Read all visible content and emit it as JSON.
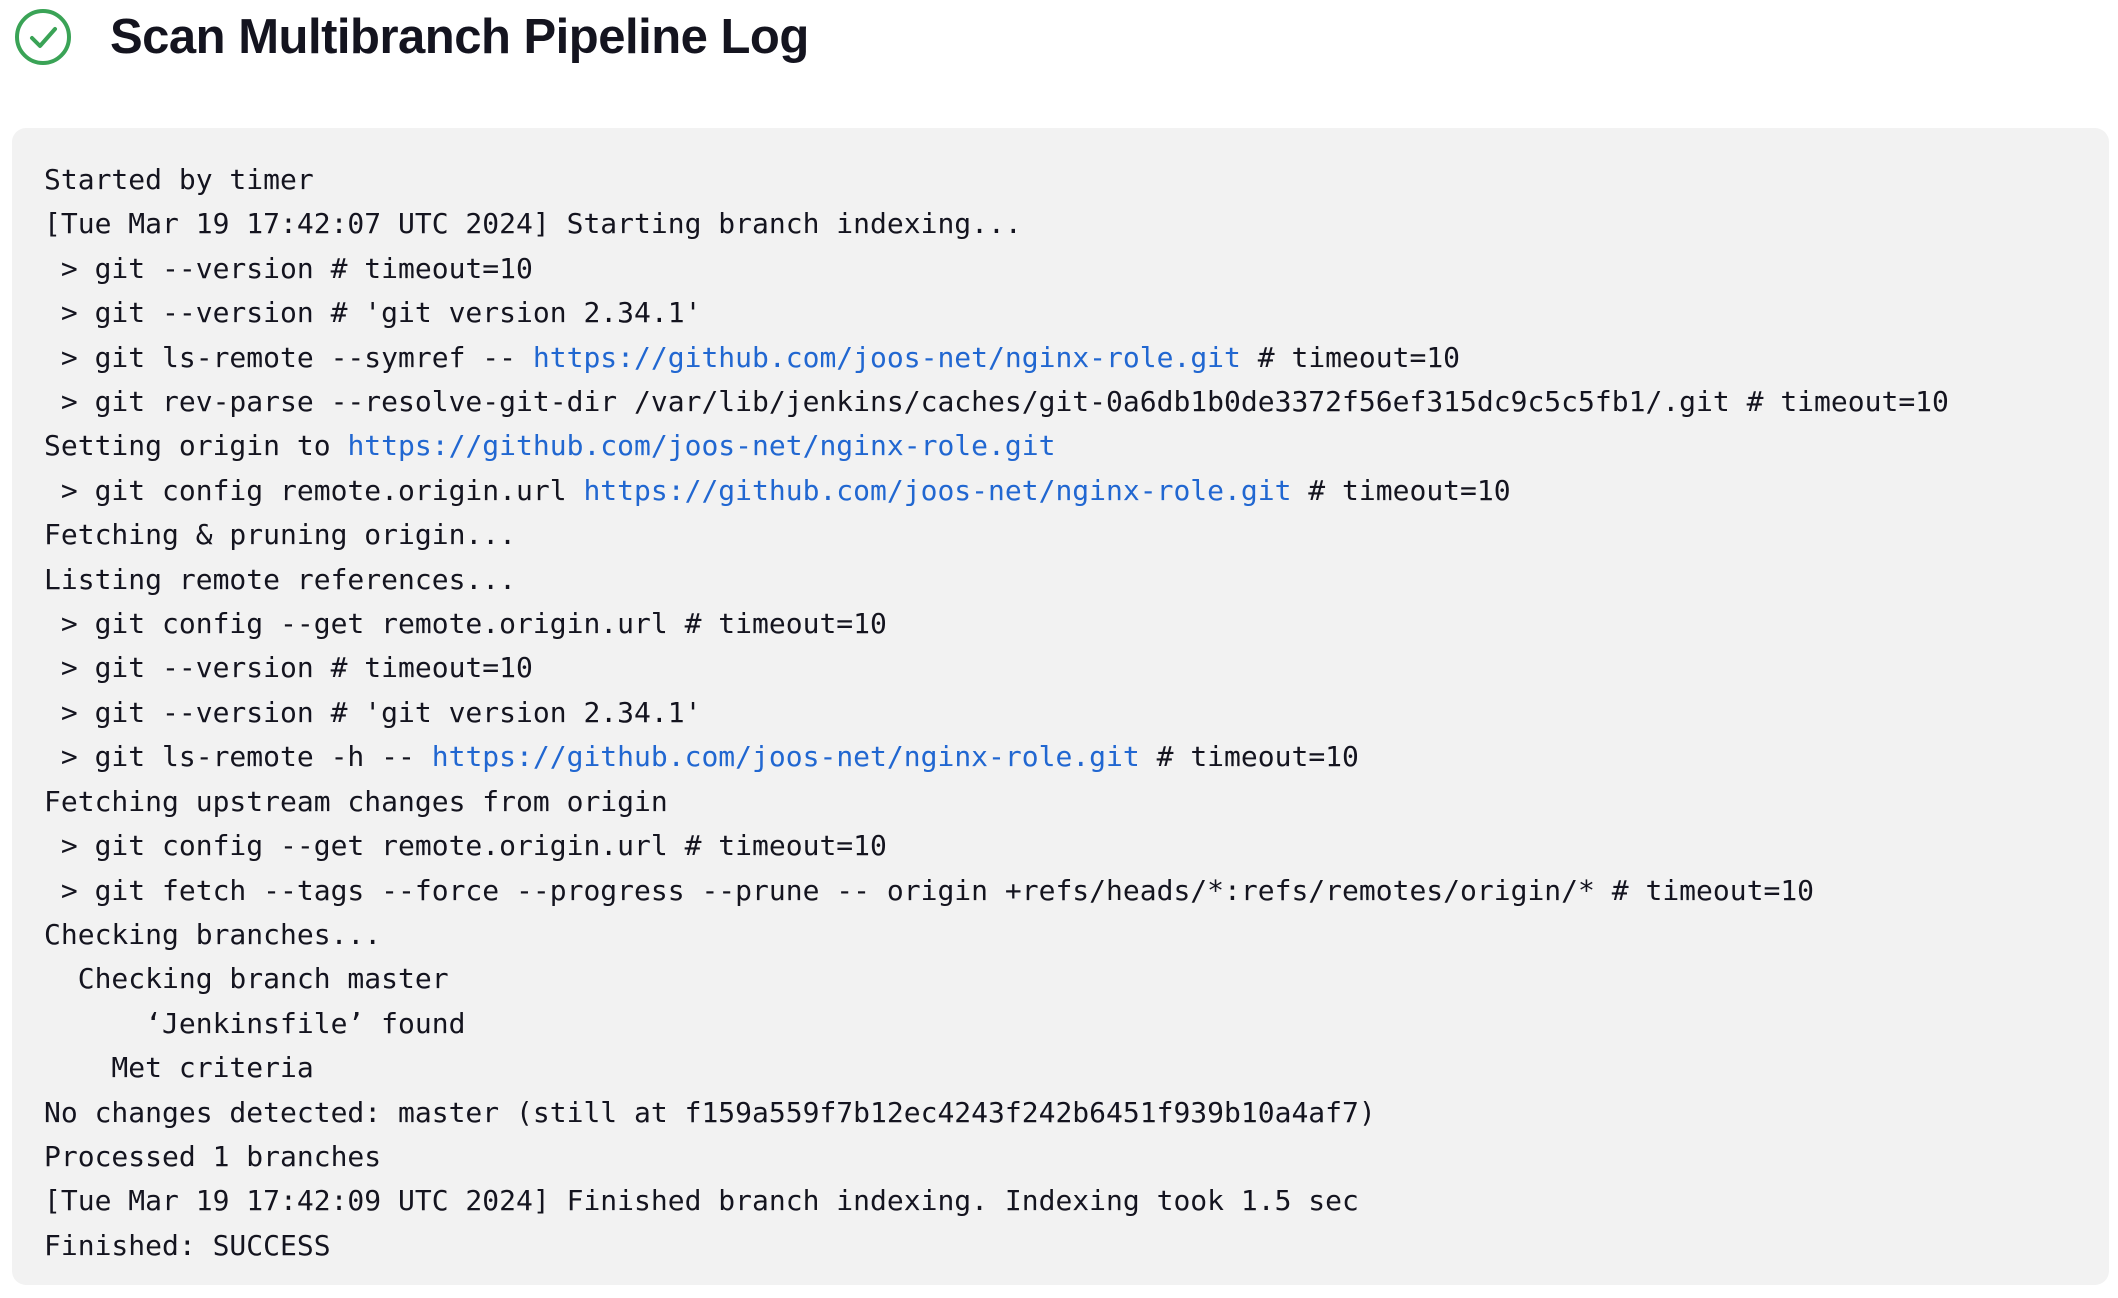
{
  "page": {
    "title": "Scan Multibranch Pipeline Log",
    "status_icon": "check-circle-icon",
    "status_color": "#3aa356",
    "link_color": "#2167d1",
    "console_background": "#f2f2f2"
  },
  "log": {
    "lines": [
      [
        {
          "text": "Started by timer"
        }
      ],
      [
        {
          "text": "[Tue Mar 19 17:42:07 UTC 2024] Starting branch indexing..."
        }
      ],
      [
        {
          "text": " > git --version # timeout=10"
        }
      ],
      [
        {
          "text": " > git --version # 'git version 2.34.1'"
        }
      ],
      [
        {
          "text": " > git ls-remote --symref -- "
        },
        {
          "text": "https://github.com/joos-net/nginx-role.git",
          "link": true
        },
        {
          "text": " # timeout=10"
        }
      ],
      [
        {
          "text": " > git rev-parse --resolve-git-dir /var/lib/jenkins/caches/git-0a6db1b0de3372f56ef315dc9c5c5fb1/.git # timeout=10"
        }
      ],
      [
        {
          "text": "Setting origin to "
        },
        {
          "text": "https://github.com/joos-net/nginx-role.git",
          "link": true
        }
      ],
      [
        {
          "text": " > git config remote.origin.url "
        },
        {
          "text": "https://github.com/joos-net/nginx-role.git",
          "link": true
        },
        {
          "text": " # timeout=10"
        }
      ],
      [
        {
          "text": "Fetching & pruning origin..."
        }
      ],
      [
        {
          "text": "Listing remote references..."
        }
      ],
      [
        {
          "text": " > git config --get remote.origin.url # timeout=10"
        }
      ],
      [
        {
          "text": " > git --version # timeout=10"
        }
      ],
      [
        {
          "text": " > git --version # 'git version 2.34.1'"
        }
      ],
      [
        {
          "text": " > git ls-remote -h -- "
        },
        {
          "text": "https://github.com/joos-net/nginx-role.git",
          "link": true
        },
        {
          "text": " # timeout=10"
        }
      ],
      [
        {
          "text": "Fetching upstream changes from origin"
        }
      ],
      [
        {
          "text": " > git config --get remote.origin.url # timeout=10"
        }
      ],
      [
        {
          "text": " > git fetch --tags --force --progress --prune -- origin +refs/heads/*:refs/remotes/origin/* # timeout=10"
        }
      ],
      [
        {
          "text": "Checking branches..."
        }
      ],
      [
        {
          "text": "  Checking branch master"
        }
      ],
      [
        {
          "text": "      ‘Jenkinsfile’ found"
        }
      ],
      [
        {
          "text": "    Met criteria"
        }
      ],
      [
        {
          "text": "No changes detected: master (still at f159a559f7b12ec4243f242b6451f939b10a4af7)"
        }
      ],
      [
        {
          "text": "Processed 1 branches"
        }
      ],
      [
        {
          "text": "[Tue Mar 19 17:42:09 UTC 2024] Finished branch indexing. Indexing took 1.5 sec"
        }
      ],
      [
        {
          "text": "Finished: SUCCESS"
        }
      ]
    ]
  }
}
